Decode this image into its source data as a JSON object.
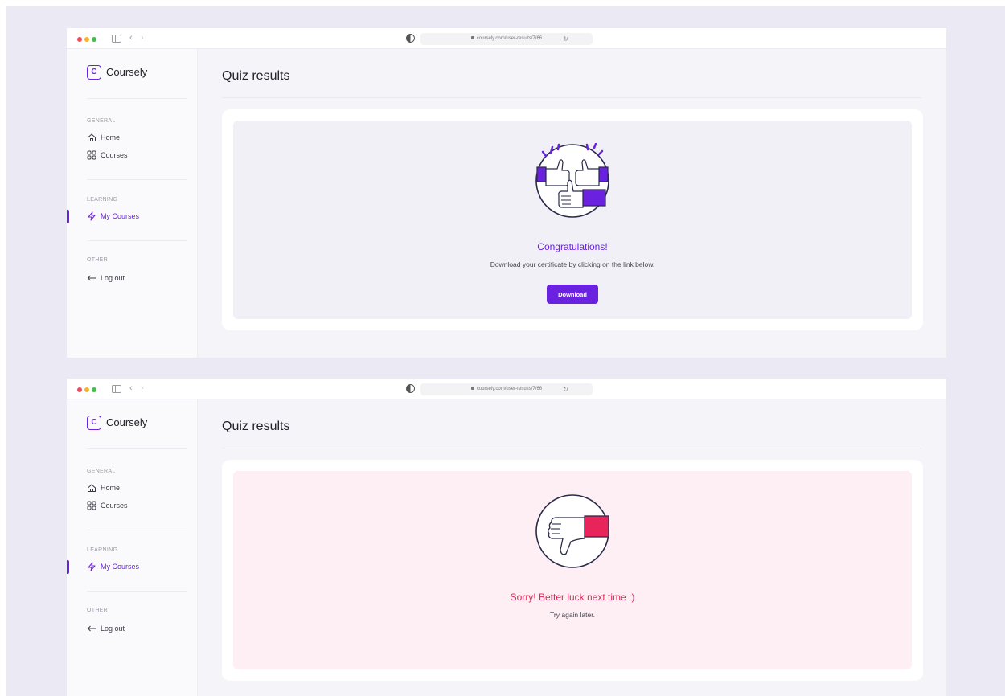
{
  "browser": {
    "url": "coursely.com/user-results/7/66"
  },
  "app": {
    "name": "Coursely",
    "logo_letter": "C",
    "accent_color": "#6a22e0"
  },
  "sidebar": {
    "sections": [
      {
        "label": "GENERAL",
        "items": [
          {
            "label": "Home",
            "icon": "home-icon"
          },
          {
            "label": "Courses",
            "icon": "grid-icon"
          }
        ]
      },
      {
        "label": "LEARNING",
        "items": [
          {
            "label": "My Courses",
            "icon": "lightning-icon",
            "active": true
          }
        ]
      },
      {
        "label": "OTHER",
        "items": [
          {
            "label": "Log out",
            "icon": "arrow-left-icon"
          }
        ]
      }
    ]
  },
  "screens": [
    {
      "page_title": "Quiz results",
      "status": "success",
      "heading": "Congratulations!",
      "message": "Download your certificate by clicking on the link below.",
      "button_label": "Download",
      "illustration": "thumbs-up-icon"
    },
    {
      "page_title": "Quiz results",
      "status": "fail",
      "heading": "Sorry! Better luck next time :)",
      "message": "Try again later.",
      "illustration": "thumbs-down-icon",
      "error_color": "#e8245a"
    }
  ]
}
